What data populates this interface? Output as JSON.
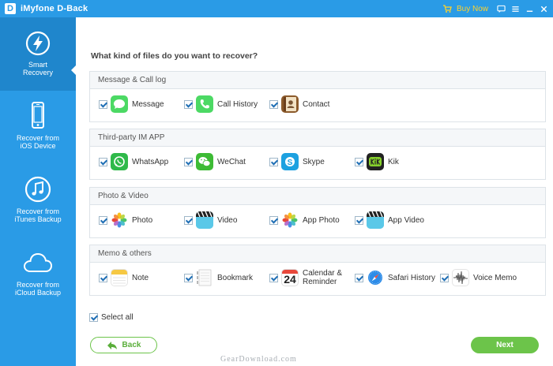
{
  "window": {
    "title": "iMyfone D-Back",
    "logo_letter": "D",
    "buy_now": "Buy Now"
  },
  "sidebar": {
    "items": [
      {
        "label": "Smart\nRecovery",
        "icon": "lightning-icon",
        "active": true
      },
      {
        "label": "Recover from\niOS Device",
        "icon": "iphone-icon",
        "active": false
      },
      {
        "label": "Recover from\niTunes Backup",
        "icon": "music-note-icon",
        "active": false
      },
      {
        "label": "Recover from\niCloud Backup",
        "icon": "cloud-icon",
        "active": false
      }
    ]
  },
  "main": {
    "question": "What kind of files do you want to recover?",
    "sections": [
      {
        "title": "Message & Call log",
        "items": [
          {
            "label": "Message",
            "checked": true
          },
          {
            "label": "Call History",
            "checked": true
          },
          {
            "label": "Contact",
            "checked": true
          }
        ]
      },
      {
        "title": "Third-party IM APP",
        "items": [
          {
            "label": "WhatsApp",
            "checked": true
          },
          {
            "label": "WeChat",
            "checked": true
          },
          {
            "label": "Skype",
            "checked": true
          },
          {
            "label": "Kik",
            "checked": true
          }
        ]
      },
      {
        "title": "Photo & Video",
        "items": [
          {
            "label": "Photo",
            "checked": true
          },
          {
            "label": "Video",
            "checked": true
          },
          {
            "label": "App Photo",
            "checked": true
          },
          {
            "label": "App Video",
            "checked": true
          }
        ]
      },
      {
        "title": "Memo & others",
        "items": [
          {
            "label": "Note",
            "checked": true
          },
          {
            "label": "Bookmark",
            "checked": true
          },
          {
            "label": "Calendar &\nReminder",
            "checked": true,
            "calendar_day": "24"
          },
          {
            "label": "Safari History",
            "checked": true
          },
          {
            "label": "Voice Memo",
            "checked": true
          }
        ]
      }
    ],
    "select_all": {
      "label": "Select all",
      "checked": true
    },
    "back_label": "Back",
    "next_label": "Next"
  },
  "watermark": "GearDownload.com",
  "colors": {
    "brand_blue": "#2a9be6",
    "sidebar_active": "#1f86cc",
    "green": "#6cc44a",
    "buy_now": "#ffd22b"
  }
}
